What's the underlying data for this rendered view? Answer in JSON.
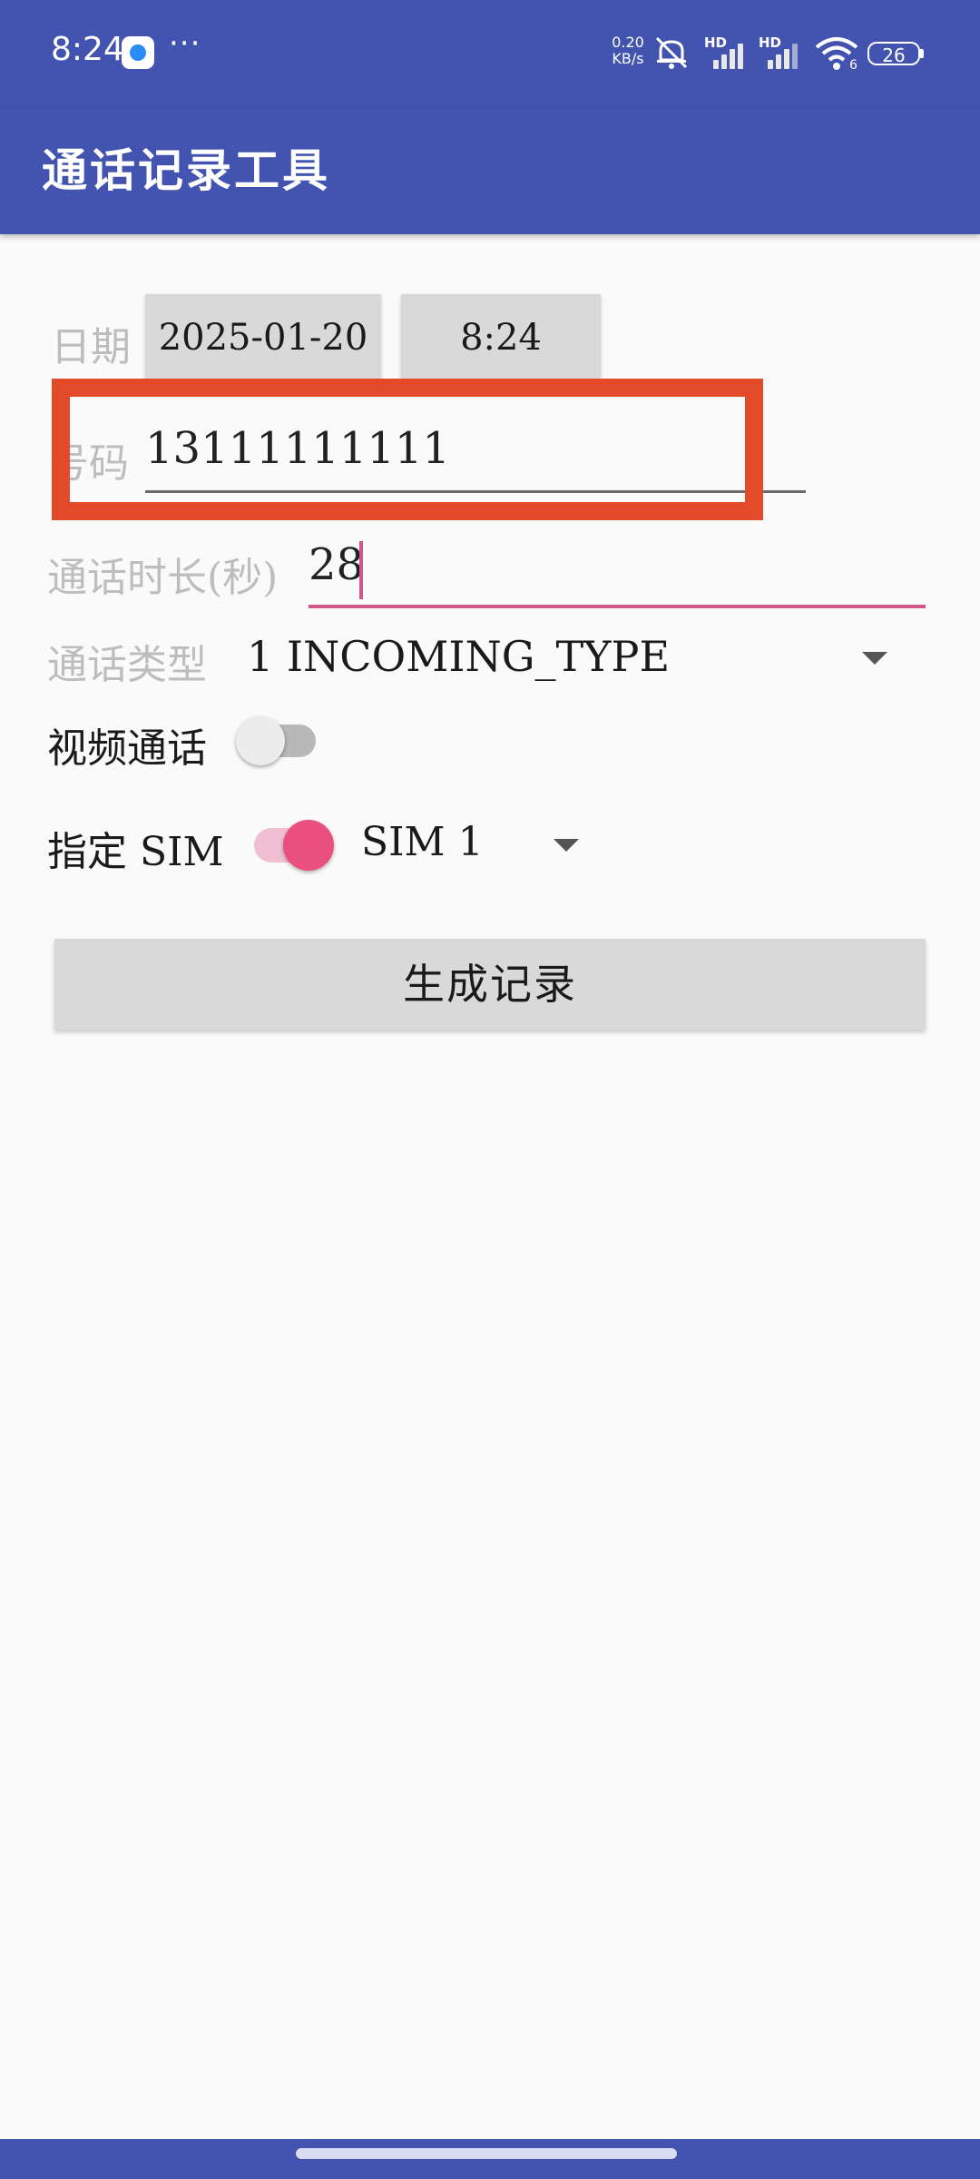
{
  "status_bar": {
    "time": "8:24",
    "more": "···",
    "net_speed_value": "0.20",
    "net_speed_unit": "KB/s",
    "sim1_label": "HD",
    "sim2_label": "HD",
    "wifi_badge": "6",
    "battery": "26"
  },
  "app_bar": {
    "title": "通话记录工具"
  },
  "form": {
    "date_label": "日期",
    "date_value": "2025-01-20",
    "time_value": "8:24",
    "number_label": "号码",
    "number_value": "13111111111",
    "duration_label": "通话时长(秒)",
    "duration_value": "28",
    "call_type_label": "通话类型",
    "call_type_value": "1 INCOMING_TYPE",
    "video_call_label": "视频通话",
    "video_call_enabled": false,
    "sim_label": "指定 SIM",
    "sim_enabled": true,
    "sim_value": "SIM 1",
    "generate_button": "生成记录"
  },
  "colors": {
    "primary": "#4253b0",
    "accent": "#e94f7f",
    "highlight_box": "#e24a2a"
  },
  "icons": [
    "app-notification-icon",
    "mute-icon",
    "signal-icon",
    "wifi-icon",
    "battery-icon",
    "dropdown-arrow-icon"
  ]
}
